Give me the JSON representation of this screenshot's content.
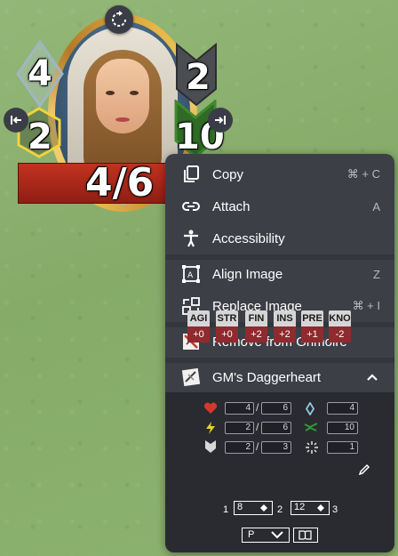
{
  "token": {
    "armor_value": "4",
    "hope_value": "2",
    "stress_value": "2",
    "evasion_value": "10",
    "hp_display": "4/6",
    "colors": {
      "hp_bar": "#b42a1c",
      "gold_ring": "#e6b545",
      "hope_hex": "#f3d23a",
      "evasion_chevron": "#3e8a2e"
    }
  },
  "menu": {
    "items": [
      {
        "label": "Copy",
        "shortcut": "⌘ + C",
        "icon": "copy-icon"
      },
      {
        "label": "Attach",
        "shortcut": "A",
        "icon": "link-icon"
      },
      {
        "label": "Accessibility",
        "shortcut": "",
        "icon": "accessibility-icon"
      },
      {
        "label": "Align Image",
        "shortcut": "Z",
        "icon": "align-image-icon"
      },
      {
        "label": "Replace Image",
        "shortcut": "⌘ + I",
        "icon": "replace-image-icon"
      },
      {
        "label": "Remove from Grimoire",
        "shortcut": "",
        "icon": "remove-grimoire-icon"
      },
      {
        "label": "GM's Daggerheart",
        "shortcut": "",
        "icon": "daggerheart-icon"
      }
    ]
  },
  "panel": {
    "hp": {
      "current": "4",
      "max": "6"
    },
    "stress": {
      "current": "2",
      "max": "6"
    },
    "armor": {
      "current": "2",
      "max": "3"
    },
    "armor_score": "4",
    "evasion": "10",
    "hope": "1",
    "traits": [
      {
        "name": "AGI",
        "value": "+0"
      },
      {
        "name": "STR",
        "value": "+0"
      },
      {
        "name": "FIN",
        "value": "+2"
      },
      {
        "name": "INS",
        "value": "+2"
      },
      {
        "name": "PRE",
        "value": "+1"
      },
      {
        "name": "KNO",
        "value": "-2"
      }
    ],
    "thresholds": {
      "t1": "1",
      "major": "8",
      "t2": "2",
      "severe": "12",
      "t3": "3"
    },
    "select_value": "P"
  }
}
